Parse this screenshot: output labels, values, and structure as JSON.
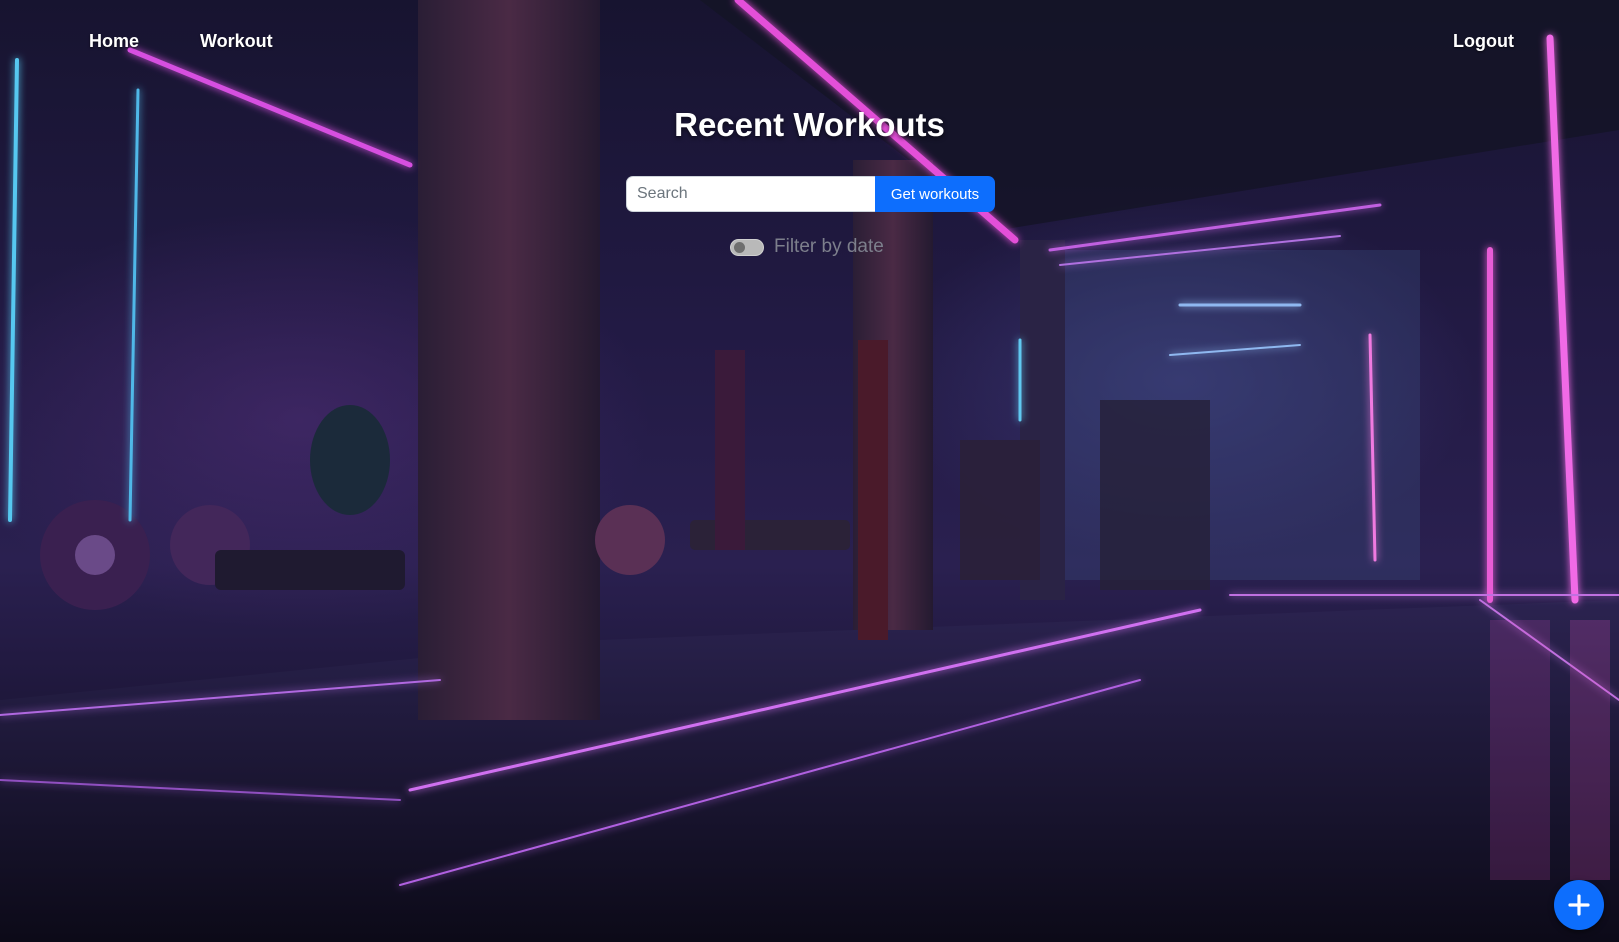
{
  "nav": {
    "home_label": "Home",
    "workout_label": "Workout",
    "logout_label": "Logout"
  },
  "page": {
    "title": "Recent Workouts"
  },
  "search": {
    "placeholder": "Search",
    "value": "",
    "button_label": "Get workouts"
  },
  "filter": {
    "label": "Filter by date",
    "enabled": false
  },
  "fab": {
    "icon": "plus-icon"
  },
  "colors": {
    "accent": "#0d6efd",
    "neon_pink": "#e34fd8",
    "neon_cyan": "#3fb4e0"
  }
}
